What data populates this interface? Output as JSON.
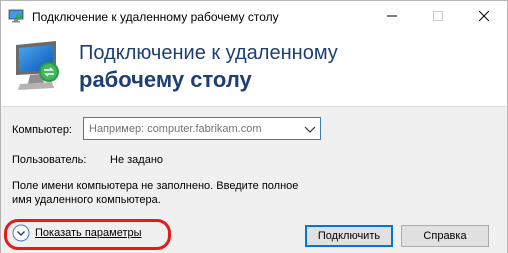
{
  "window": {
    "title": "Подключение к удаленному рабочему столу",
    "controls": [
      "minimize-icon",
      "maximize-icon",
      "close-icon"
    ]
  },
  "banner": {
    "line1": "Подключение к удаленному",
    "line2": "рабочему столу",
    "title_color": "#1e3f74"
  },
  "form": {
    "computer_label": "Компьютер:",
    "computer_placeholder": "Например: computer.fabrikam.com",
    "computer_value": "",
    "user_label": "Пользователь:",
    "user_value": "Не задано",
    "message": "Поле имени компьютера не заполнено. Введите полное имя удаленного компьютера."
  },
  "footer": {
    "show_options_label": "Показать параметры",
    "connect_label": "Подключить",
    "help_label": "Справка",
    "highlight_color": "#e21b1b"
  }
}
